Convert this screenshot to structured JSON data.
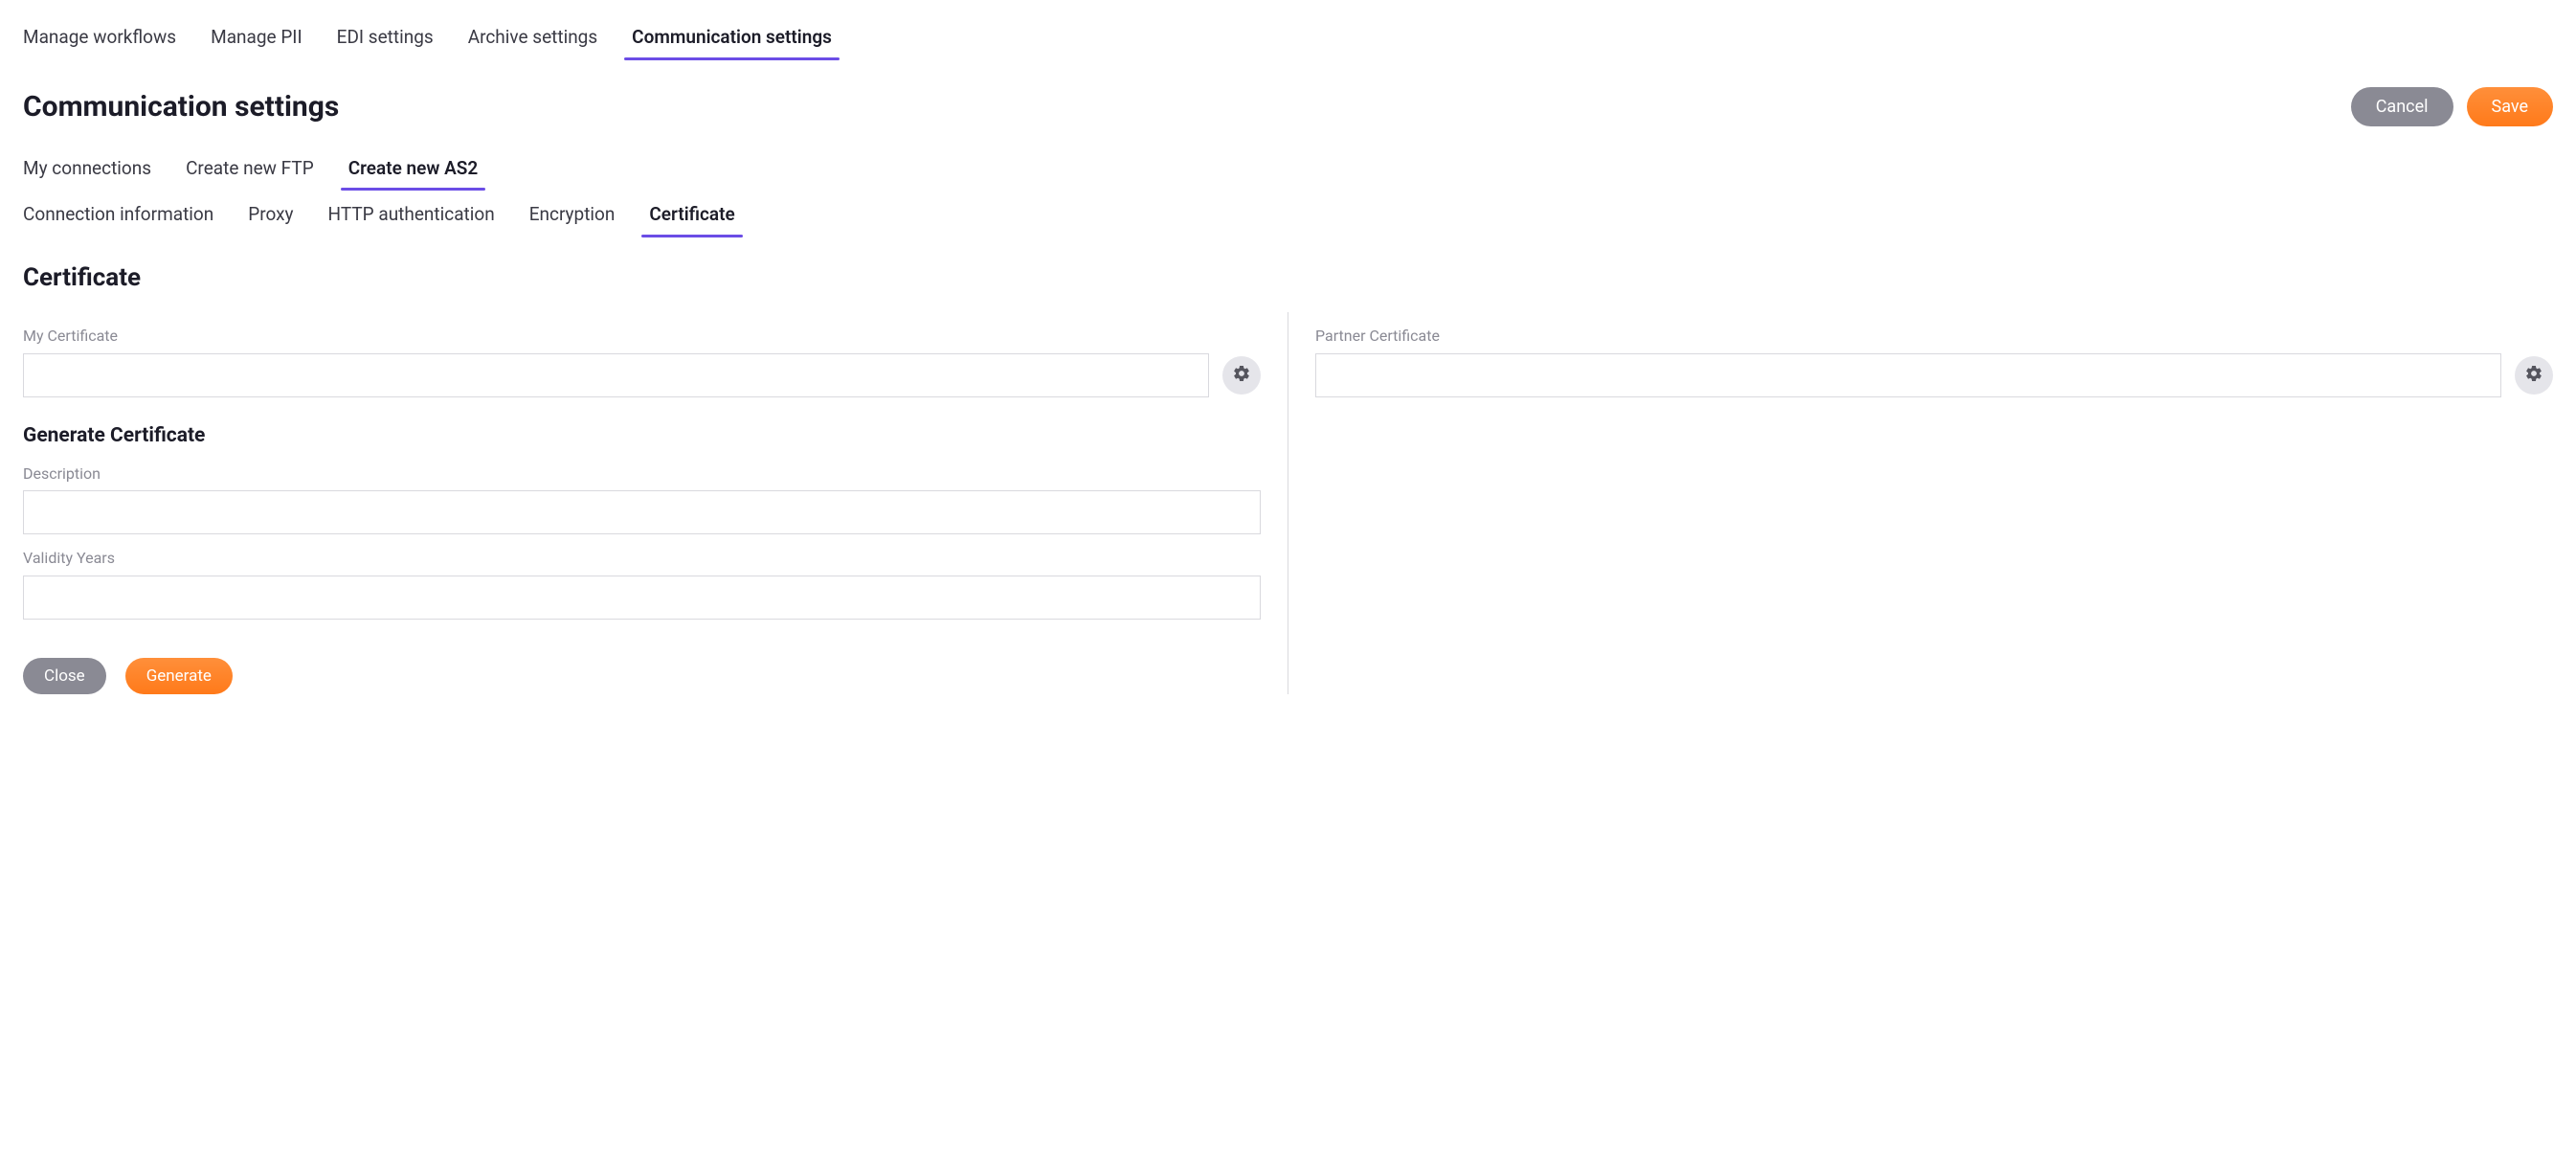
{
  "nav1": {
    "items": [
      {
        "label": "Manage workflows",
        "active": false
      },
      {
        "label": "Manage PII",
        "active": false
      },
      {
        "label": "EDI settings",
        "active": false
      },
      {
        "label": "Archive settings",
        "active": false
      },
      {
        "label": "Communication settings",
        "active": true
      }
    ]
  },
  "page_heading": "Communication settings",
  "top_buttons": {
    "cancel": "Cancel",
    "save": "Save"
  },
  "nav2": {
    "items": [
      {
        "label": "My connections",
        "active": false
      },
      {
        "label": "Create new FTP",
        "active": false
      },
      {
        "label": "Create new AS2",
        "active": true
      }
    ]
  },
  "nav3": {
    "items": [
      {
        "label": "Connection information",
        "active": false
      },
      {
        "label": "Proxy",
        "active": false
      },
      {
        "label": "HTTP authentication",
        "active": false
      },
      {
        "label": "Encryption",
        "active": false
      },
      {
        "label": "Certificate",
        "active": true
      }
    ]
  },
  "section_title": "Certificate",
  "left": {
    "my_cert_label": "My Certificate",
    "my_cert_value": "",
    "generate_heading": "Generate Certificate",
    "description_label": "Description",
    "description_value": "",
    "validity_label": "Validity Years",
    "validity_value": "",
    "close_btn": "Close",
    "generate_btn": "Generate"
  },
  "right": {
    "partner_cert_label": "Partner Certificate",
    "partner_cert_value": ""
  },
  "icons": {
    "my_cert_gear": "gear-icon",
    "partner_cert_gear": "gear-icon"
  }
}
